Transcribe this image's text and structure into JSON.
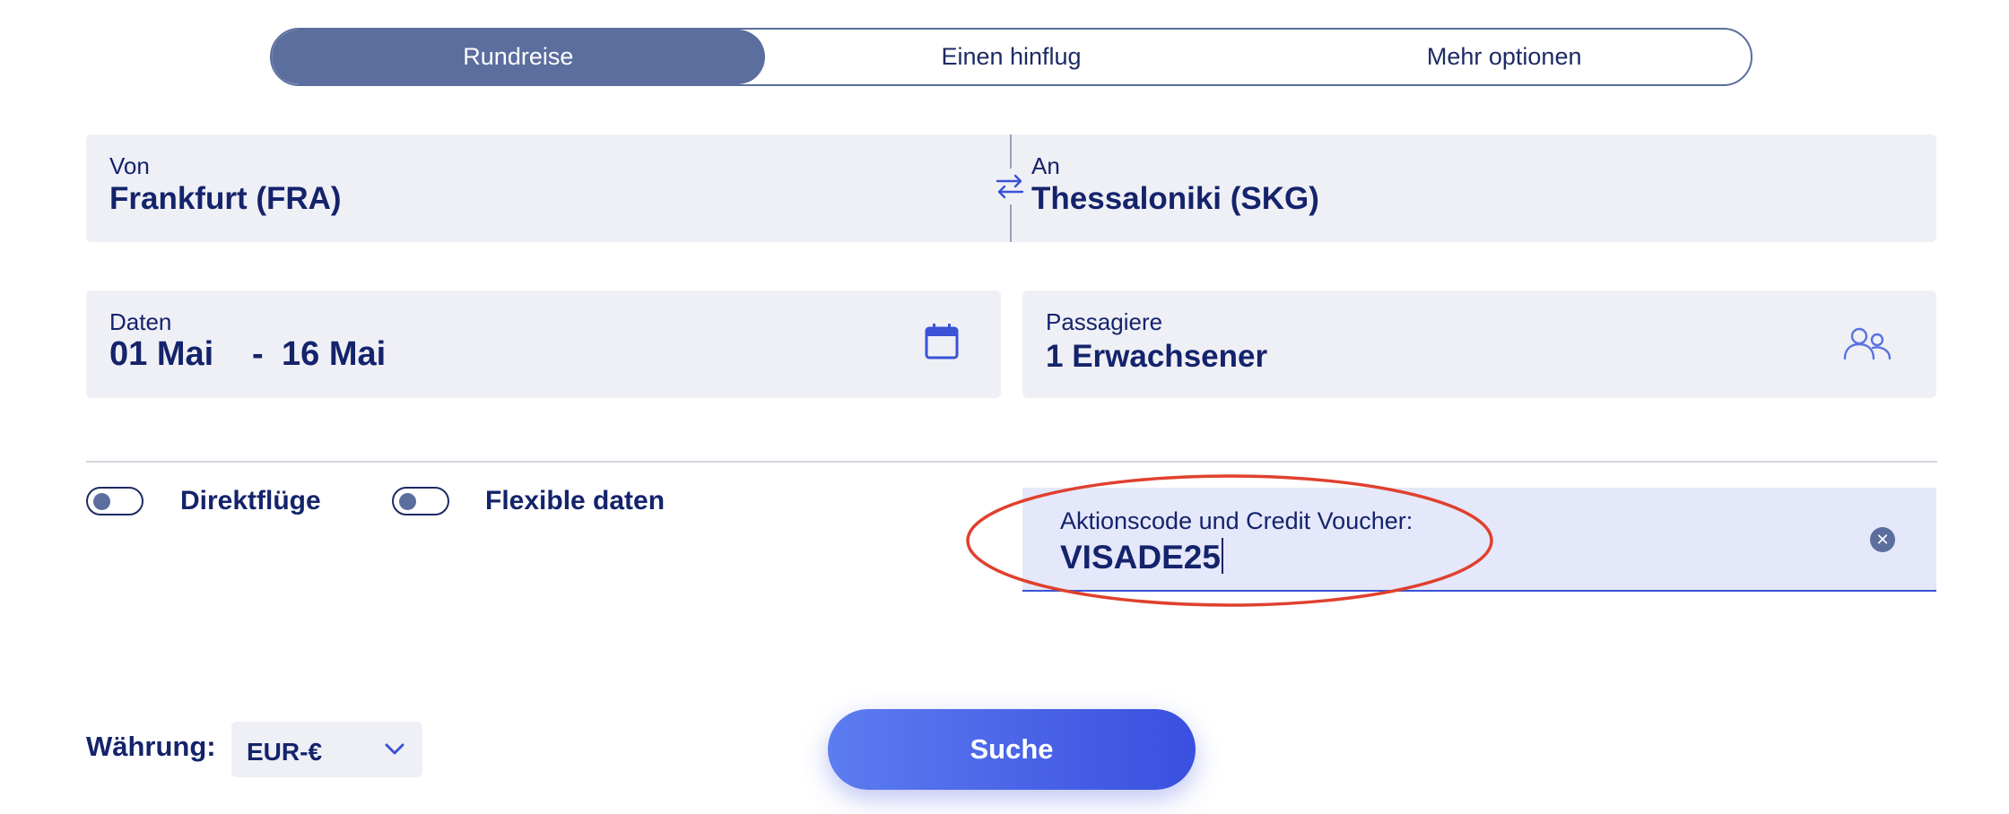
{
  "trip_tabs": {
    "items": [
      {
        "label": "Rundreise"
      },
      {
        "label": "Einen hinflug"
      },
      {
        "label": "Mehr optionen"
      }
    ]
  },
  "route": {
    "from_label": "Von",
    "from_value": "Frankfurt (FRA)",
    "to_label": "An",
    "to_value": "Thessaloniki (SKG)",
    "swap_icon": "swap-arrows-icon"
  },
  "dates": {
    "label": "Daten",
    "start": "01 Mai",
    "separator": "-",
    "end": "16 Mai",
    "icon": "calendar-icon"
  },
  "passengers": {
    "label": "Passagiere",
    "value": "1 Erwachsener",
    "icon": "people-icon"
  },
  "options": {
    "direct_label": "Direktflüge",
    "flexible_label": "Flexible daten"
  },
  "promo": {
    "label": "Aktionscode und Credit Voucher:",
    "value": "VISADE25",
    "clear_icon": "clear-icon"
  },
  "currency": {
    "label": "Währung:",
    "value": "EUR-€"
  },
  "search": {
    "label": "Suche"
  },
  "colors": {
    "primary_text": "#14236b",
    "active_tab": "#5b6e9d",
    "field_bg": "#eff0f6",
    "promo_bg": "#e4e8fa",
    "accent_blue": "#3a52d6",
    "highlight_red": "#e0402e"
  }
}
